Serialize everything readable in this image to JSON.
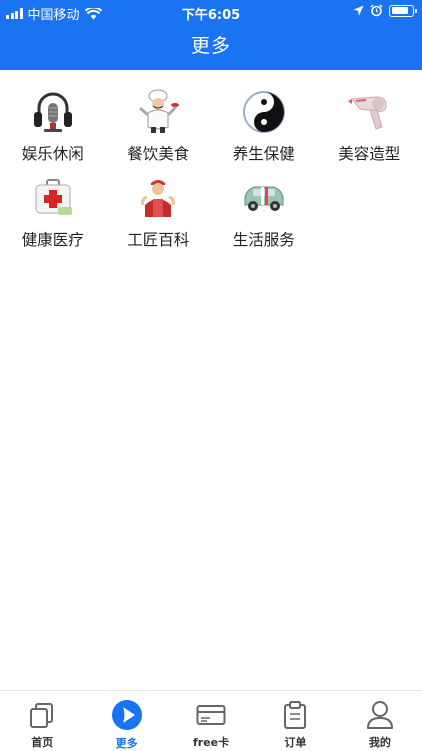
{
  "status_bar": {
    "carrier": "中国移动",
    "time": "下午6:05",
    "battery_level": 0.8
  },
  "header": {
    "title": "更多"
  },
  "categories": [
    {
      "label": "娱乐休闲",
      "icon": "headphones-icon"
    },
    {
      "label": "餐饮美食",
      "icon": "chef-icon"
    },
    {
      "label": "养生保健",
      "icon": "yin-yang-icon"
    },
    {
      "label": "美容造型",
      "icon": "hair-dryer-icon"
    },
    {
      "label": "健康医疗",
      "icon": "first-aid-kit-icon"
    },
    {
      "label": "工匠百科",
      "icon": "craftsman-icon"
    },
    {
      "label": "生活服务",
      "icon": "car-icon"
    }
  ],
  "tab_bar": {
    "active": 1,
    "accent": "#1a73f0",
    "tabs": [
      {
        "label": "首页",
        "icon": "home-pages-icon"
      },
      {
        "label": "更多",
        "icon": "play-more-icon"
      },
      {
        "label": "free卡",
        "icon": "card-icon"
      },
      {
        "label": "订单",
        "icon": "clipboard-icon"
      },
      {
        "label": "我的",
        "icon": "user-icon"
      }
    ]
  }
}
